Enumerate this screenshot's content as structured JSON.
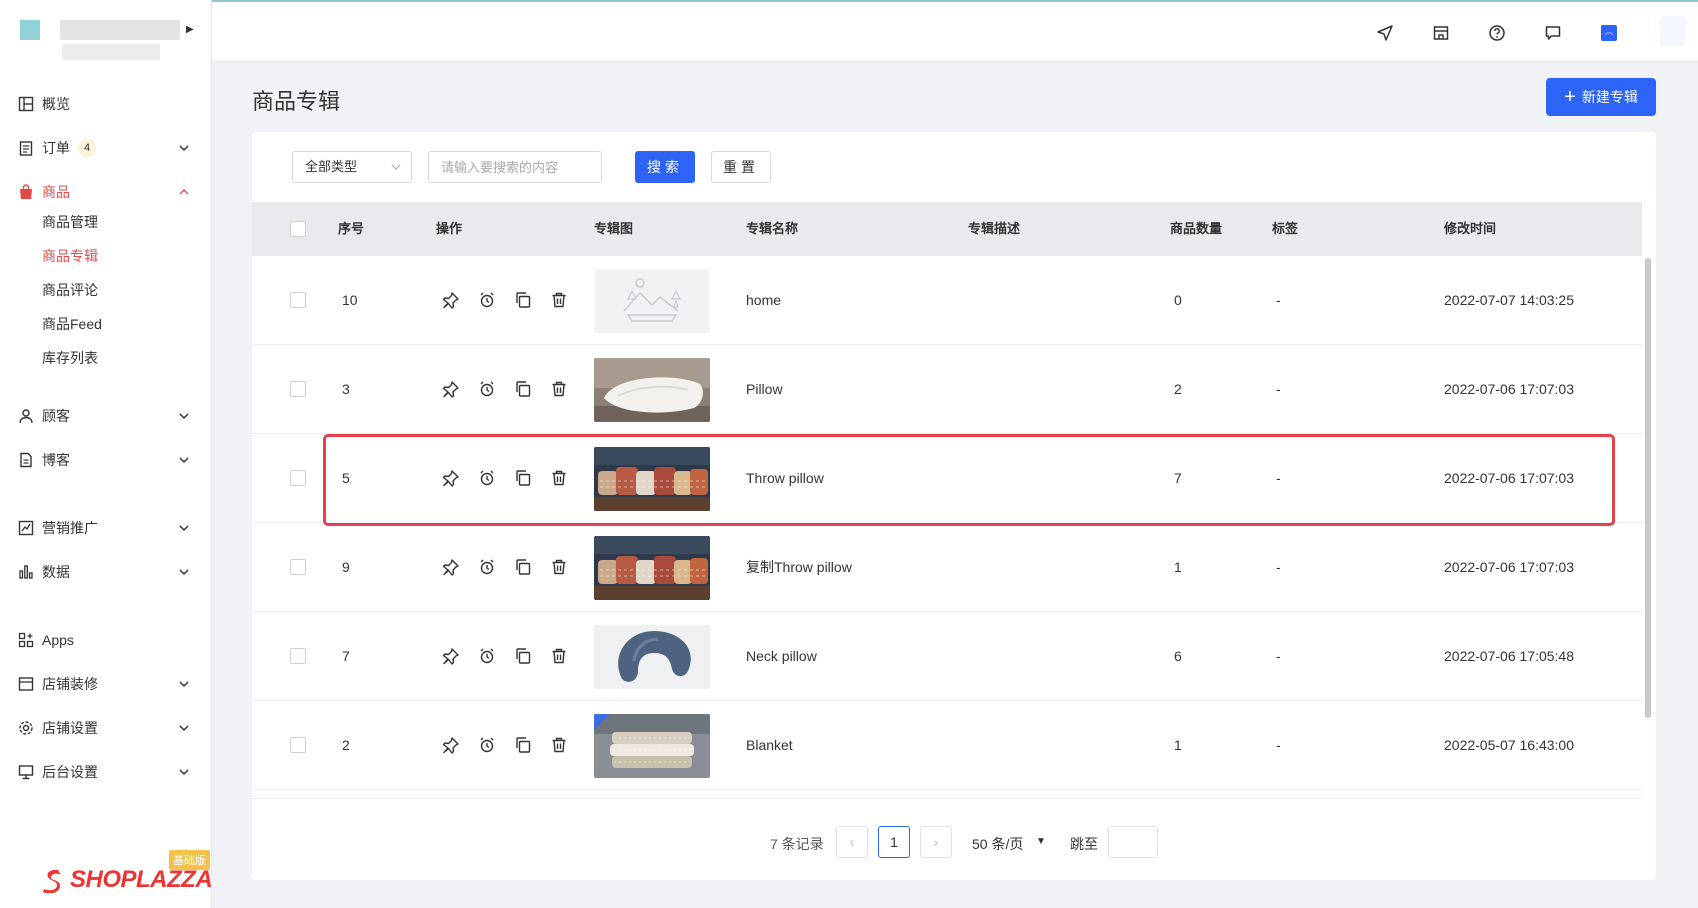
{
  "sidebar": {
    "nav": {
      "overview": "概览",
      "orders": "订单",
      "orders_badge": "4",
      "products": "商品",
      "customers": "顾客",
      "blog": "博客",
      "marketing": "营销推广",
      "data": "数据",
      "apps": "Apps",
      "store_design": "店铺装修",
      "store_settings": "店铺设置",
      "admin_settings": "后台设置"
    },
    "product_sub": [
      "商品管理",
      "商品专辑",
      "商品评论",
      "商品Feed",
      "库存列表"
    ],
    "active_sub": "商品专辑",
    "plan_tag": "基础版",
    "brand_name": "SHOPLAZZA"
  },
  "header": {
    "icons": [
      "send-icon",
      "store-icon",
      "help-icon",
      "chat-icon",
      "notification-icon"
    ]
  },
  "page": {
    "title": "商品专辑",
    "new_button": "新建专辑"
  },
  "filters": {
    "type_value": "全部类型",
    "search_placeholder": "请输入要搜索的内容",
    "search_label": "搜索",
    "reset_label": "重置"
  },
  "table": {
    "headers": {
      "index": "序号",
      "actions": "操作",
      "image": "专辑图",
      "name": "专辑名称",
      "description": "专辑描述",
      "count": "商品数量",
      "tags": "标签",
      "modified": "修改时间"
    },
    "rows": [
      {
        "index": "10",
        "image": "placeholder-landscape",
        "name": "home",
        "count": "0",
        "tags": "-",
        "modified": "2022-07-07 14:03:25"
      },
      {
        "index": "3",
        "image": "pillow-photo",
        "name": "Pillow",
        "count": "2",
        "tags": "-",
        "modified": "2022-07-06 17:07:03"
      },
      {
        "index": "5",
        "image": "throw-pillows-photo",
        "name": "Throw pillow",
        "count": "7",
        "tags": "-",
        "modified": "2022-07-06 17:07:03"
      },
      {
        "index": "9",
        "image": "throw-pillows-photo",
        "name": "复制Throw pillow",
        "count": "1",
        "tags": "-",
        "modified": "2022-07-06 17:07:03"
      },
      {
        "index": "7",
        "image": "neck-pillow-photo",
        "name": "Neck pillow",
        "count": "6",
        "tags": "-",
        "modified": "2022-07-06 17:05:48"
      },
      {
        "index": "2",
        "image": "blanket-photo",
        "name": "Blanket",
        "count": "1",
        "tags": "-",
        "modified": "2022-05-07 16:43:00"
      }
    ],
    "highlighted_index": "5"
  },
  "pagination": {
    "total": "7 条记录",
    "prev": "‹",
    "current": "1",
    "next": "›",
    "page_size": "50 条/页",
    "jump_label": "跳至"
  },
  "colors": {
    "primary": "#2e64f5",
    "active_nav": "#e24a4a",
    "highlight": "#e0434a"
  }
}
